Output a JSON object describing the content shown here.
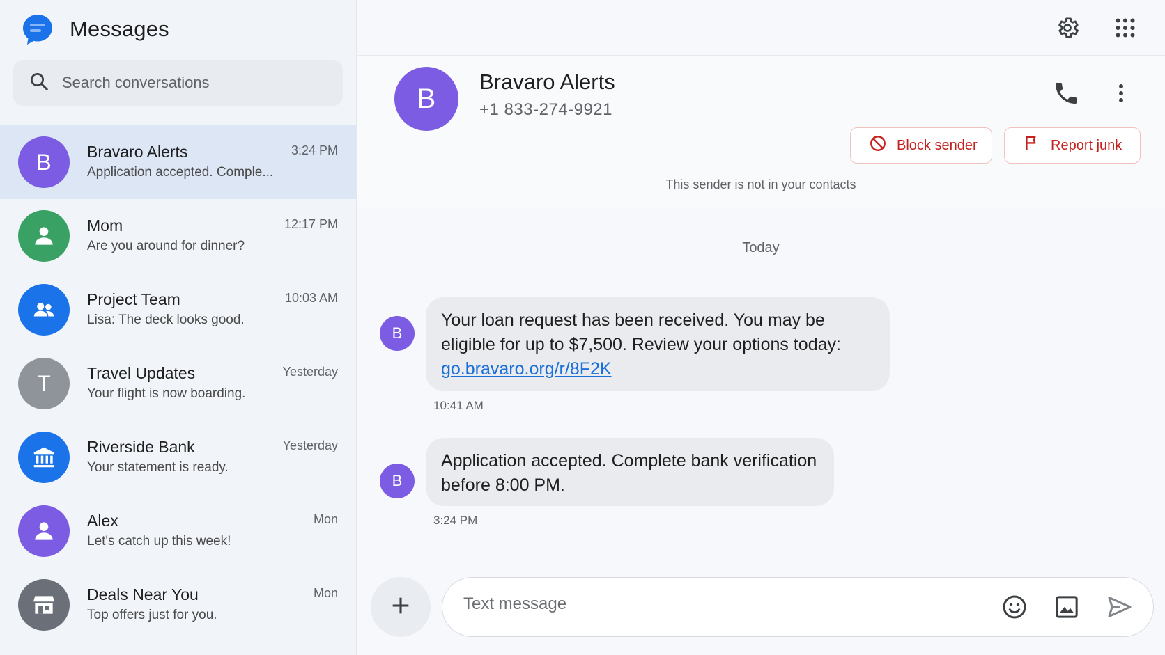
{
  "app": {
    "title": "Messages",
    "logo_icon": "messages-logo-icon"
  },
  "search": {
    "placeholder": "Search conversations",
    "icon": "search-icon"
  },
  "conversations": [
    {
      "name": "Bravaro Alerts",
      "snippet": "Application accepted. Comple...",
      "time": "3:24 PM",
      "avatar_letter": "B",
      "avatar_color": "#7b5ce2",
      "active": true
    },
    {
      "name": "Mom",
      "snippet": "Are you around for dinner?",
      "time": "12:17 PM",
      "avatar_icon": "person-icon",
      "avatar_color": "#3aa164"
    },
    {
      "name": "Project Team",
      "snippet": "Lisa: The deck looks good.",
      "time": "10:03 AM",
      "avatar_icon": "group-icon",
      "avatar_color": "#1a73e8"
    },
    {
      "name": "Travel Updates",
      "snippet": "Your flight is now boarding.",
      "time": "Yesterday",
      "avatar_letter": "T",
      "avatar_color": "#8f949b"
    },
    {
      "name": "Riverside Bank",
      "snippet": "Your statement is ready.",
      "time": "Yesterday",
      "avatar_icon": "bank-icon",
      "avatar_color": "#1a73e8"
    },
    {
      "name": "Alex",
      "snippet": "Let's catch up this week!",
      "time": "Mon",
      "avatar_icon": "person-icon",
      "avatar_color": "#7b5ce2"
    },
    {
      "name": "Deals Near You",
      "snippet": "Top offers just for you.",
      "time": "Mon",
      "avatar_icon": "store-icon",
      "avatar_color": "#6b7078"
    }
  ],
  "topbar": {
    "settings_icon": "gear-icon",
    "apps_icon": "apps-grid-icon"
  },
  "contact": {
    "avatar_letter": "B",
    "name": "Bravaro Alerts",
    "number": "+1 833-274-9921",
    "block_label": "Block sender",
    "report_label": "Report junk",
    "not_in_contacts": "This sender is not in your contacts"
  },
  "thread": {
    "day_label": "Today",
    "messages": [
      {
        "avatar_letter": "B",
        "text": "Your loan request has been received. You may be eligible for up to $7,500. Review your options today:",
        "link": "go.bravaro.org/r/8F2K",
        "time": "10:41 AM"
      },
      {
        "avatar_letter": "B",
        "text": "Application accepted. Complete bank verification before 8:00 PM.",
        "time": "3:24 PM"
      }
    ]
  },
  "composer": {
    "placeholder": "Text message"
  },
  "colors": {
    "accent": "#1a73e8",
    "danger": "#c5221f",
    "active_row": "#dde6f5"
  }
}
